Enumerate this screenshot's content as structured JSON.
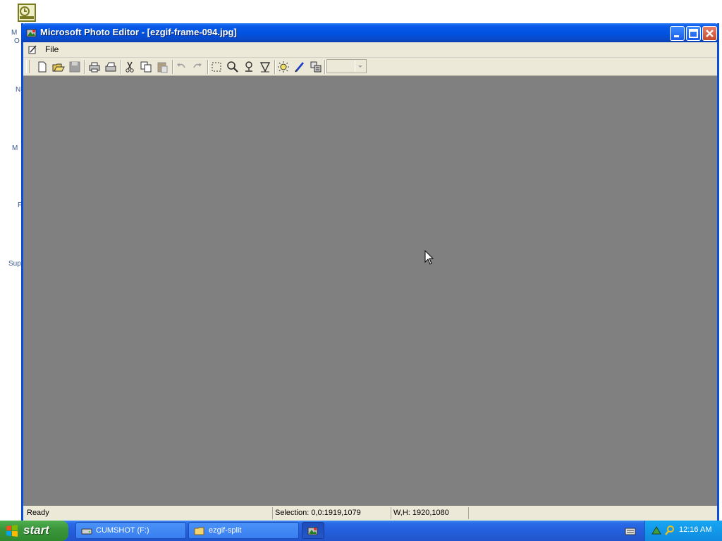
{
  "desktop": {
    "icon_labels": [
      "M",
      "O",
      "N",
      "M",
      "F",
      "Sup"
    ]
  },
  "window": {
    "title": "Microsoft Photo Editor - [ezgif-frame-094.jpg]",
    "controls": [
      "minimize-icon",
      "maximize-icon",
      "close-icon"
    ],
    "menu": {
      "file_label": "File"
    },
    "toolbar": {
      "tools": [
        "new-icon",
        "open-icon",
        "save-icon",
        "print-icon",
        "scan-icon",
        "cut-icon",
        "copy-icon",
        "paste-icon",
        "undo-icon",
        "redo-icon",
        "select-icon",
        "zoom-icon",
        "smudge-icon",
        "transparency-icon",
        "balance-icon",
        "edit-icon",
        "properties-icon"
      ],
      "zoom_value": ""
    },
    "status": {
      "message": "Ready",
      "selection": "Selection: 0,0:1919,1079",
      "size": "W,H: 1920,1080"
    },
    "workspace_color": "#808080"
  },
  "taskbar": {
    "start_label": "start",
    "buttons": [
      {
        "label": "CUMSHOT (F:)",
        "icon": "drive-icon"
      },
      {
        "label": "ezgif-split",
        "icon": "folder-icon"
      },
      {
        "label": "",
        "icon": "photo-editor-icon"
      }
    ],
    "tray": {
      "clock": "12:16 AM"
    }
  },
  "colors": {
    "titlebar": "#0052e0",
    "taskbar": "#245fdc",
    "start": "#3c963c",
    "tray": "#0f8ae0"
  }
}
